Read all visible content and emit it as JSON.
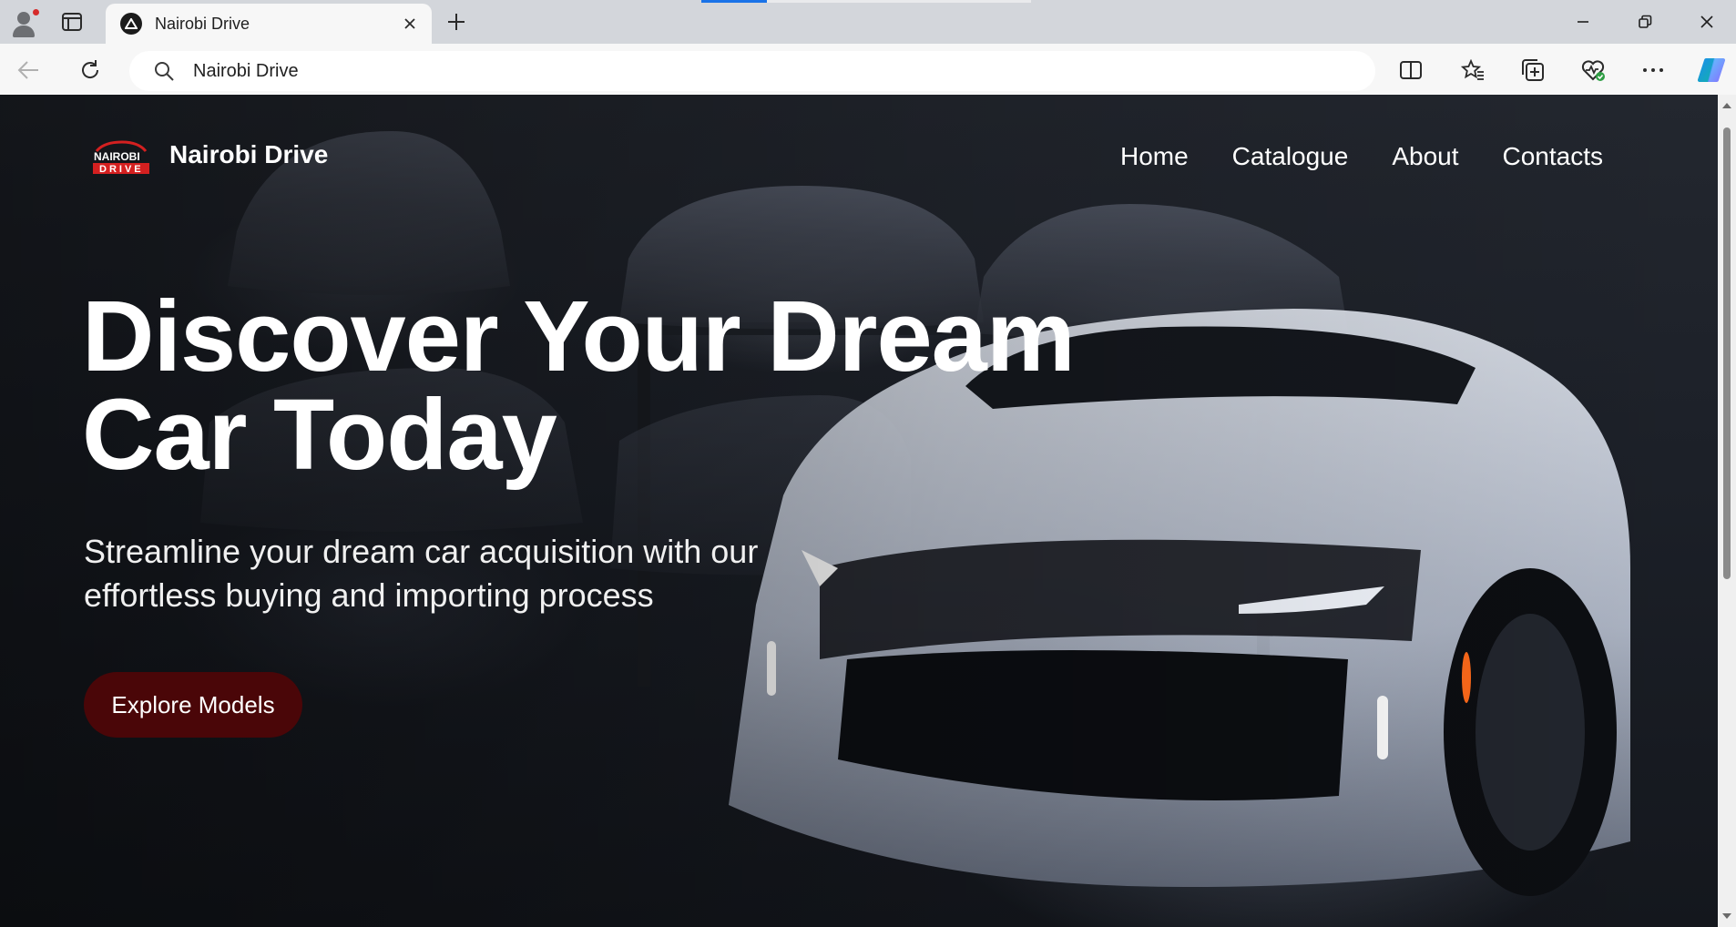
{
  "browser": {
    "tab": {
      "title": "Nairobi Drive",
      "favicon": "site-triangle-icon",
      "close_icon": "close-icon"
    },
    "new_tab_icon": "plus-icon",
    "address_bar": {
      "value": "Nairobi Drive",
      "icon": "search-icon"
    },
    "toolbar_icons": [
      "back-arrow-icon",
      "reload-icon",
      "split-screen-icon",
      "favorites-icon",
      "collections-icon",
      "browser-essentials-icon",
      "more-icon",
      "copilot-icon"
    ],
    "window_controls": [
      "minimize-icon",
      "restore-icon",
      "close-icon"
    ],
    "profile_notification_color": "#d62b2b"
  },
  "site": {
    "logo": {
      "line1": "NAIROBI",
      "line2": "DRIVE",
      "brand_color": "#d42020"
    },
    "brand_name": "Nairobi Drive",
    "nav": [
      "Home",
      "Catalogue",
      "About",
      "Contacts"
    ],
    "hero": {
      "title_line1": "Discover Your Dream",
      "title_line2": "Car Today",
      "subtitle_line1": "Streamline your dream car acquisition with our",
      "subtitle_line2": "effortless buying and importing process",
      "cta_label": "Explore Models",
      "cta_color": "#4a0608"
    }
  }
}
